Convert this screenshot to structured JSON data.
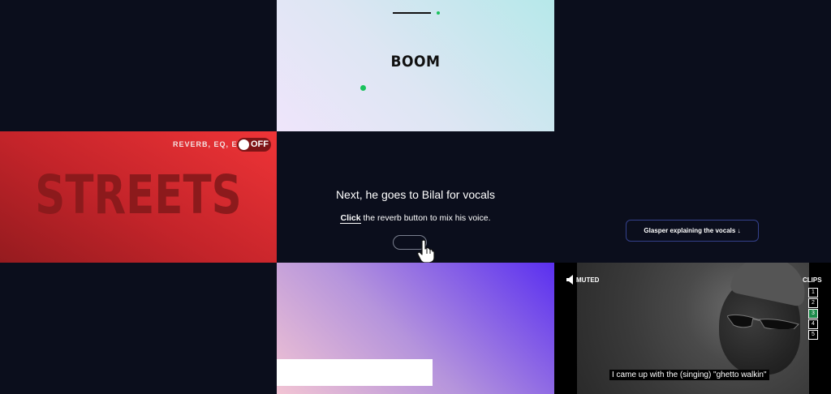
{
  "boom_panel": {
    "word": "BOOM",
    "accent_color": "#19c25c"
  },
  "streets_panel": {
    "word": "STREETS",
    "effects_label": "REVERB, EQ, ETC.",
    "toggle_state": "OFF"
  },
  "instructions": {
    "title": "Next, he goes to Bilal for vocals",
    "click_word": "Click",
    "rest_text": " the reverb button to mix his voice.",
    "hand_icon": "pointer-hand-icon"
  },
  "vocals_button": {
    "label": "Glasper explaining the vocals ↓"
  },
  "video": {
    "muted_label": "MUTED",
    "clips_label": "CLIPS",
    "clips": [
      "1",
      "2",
      "3",
      "4",
      "5"
    ],
    "active_clip": "3",
    "active_color": "#1d8a4a",
    "subtitle": "I came up with the (singing) \"ghetto walkin\""
  }
}
